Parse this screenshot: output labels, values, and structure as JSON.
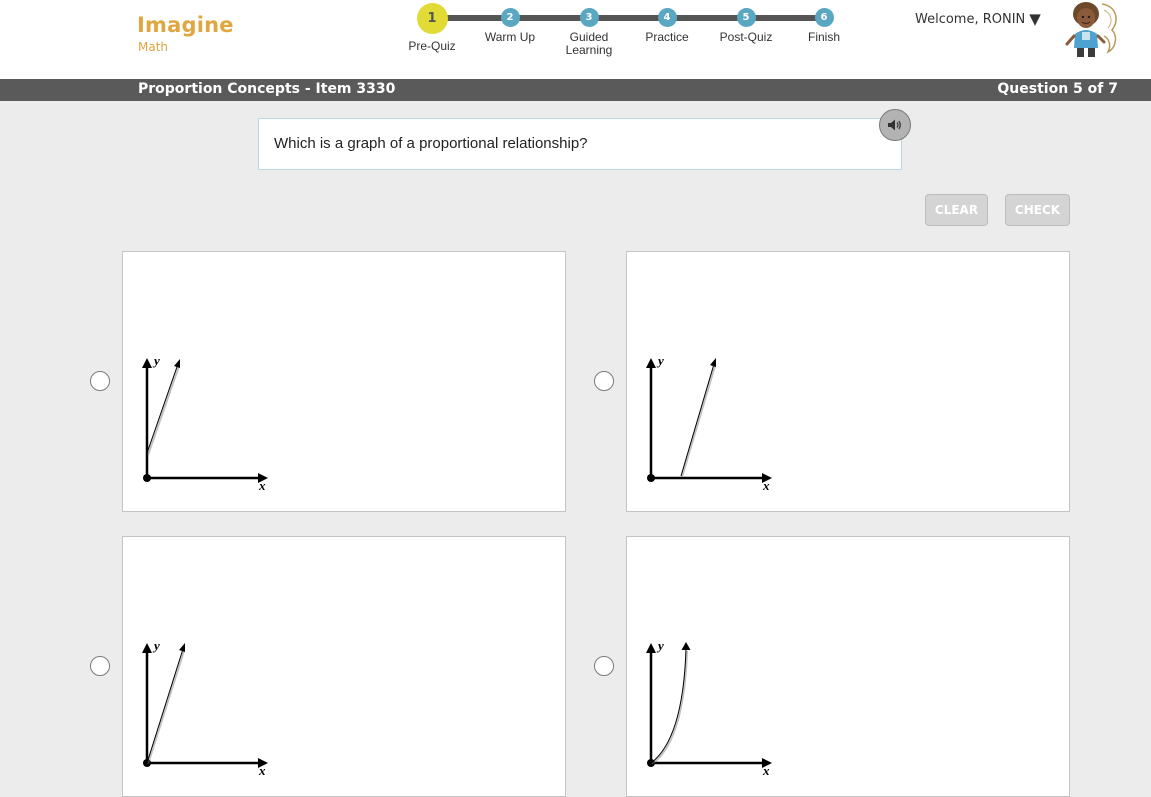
{
  "brand": {
    "name": "Imagine",
    "sub": "Math"
  },
  "progress": {
    "current_step": 1,
    "steps": [
      {
        "num": "1",
        "label": "Pre-Quiz"
      },
      {
        "num": "2",
        "label": "Warm Up"
      },
      {
        "num": "3",
        "label": "Guided Learning"
      },
      {
        "num": "4",
        "label": "Practice"
      },
      {
        "num": "5",
        "label": "Post-Quiz"
      },
      {
        "num": "6",
        "label": "Finish"
      }
    ]
  },
  "user": {
    "welcome": "Welcome, RONIN",
    "caret": "▼"
  },
  "titlebar": {
    "lesson": "Proportion Concepts - Item 3330",
    "question_count": "Question 5 of 7"
  },
  "question": {
    "text": "Which is a graph of a proportional relationship?"
  },
  "buttons": {
    "clear": "CLEAR",
    "check": "CHECK"
  },
  "axis_labels": {
    "x": "x",
    "y": "y"
  },
  "choices": [
    {
      "id": "a",
      "selected": false,
      "line": "steep straight line from a point on the y-axis above the origin"
    },
    {
      "id": "b",
      "selected": false,
      "line": "straight line starting from a point on the x-axis right of the origin"
    },
    {
      "id": "c",
      "selected": false,
      "line": "straight line through the origin"
    },
    {
      "id": "d",
      "selected": false,
      "line": "curve through the origin"
    }
  ],
  "colors": {
    "brand": "#e0a640",
    "step": "#5aa7c2",
    "current_step": "#e2db35",
    "titlebar": "#5a5a5a"
  }
}
